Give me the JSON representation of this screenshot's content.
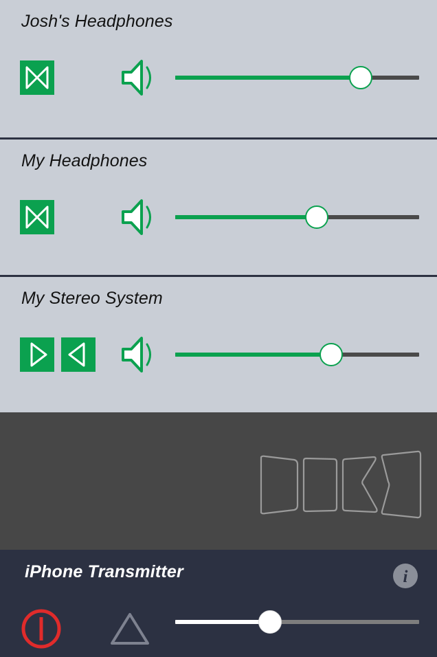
{
  "app": {
    "background_color": "#c9ced6",
    "accent_color": "#0ba14f",
    "divider_color": "#2c3142",
    "track_color": "#4a4a4a"
  },
  "devices": [
    {
      "name": "Josh's Headphones",
      "buttons": [
        {
          "icon": "bowtie-both-channels-icon",
          "label": "Both channels"
        }
      ],
      "volume_icon": "speaker-volume-icon",
      "volume_percent": 76
    },
    {
      "name": "My Headphones",
      "buttons": [
        {
          "icon": "bowtie-both-channels-icon",
          "label": "Both channels"
        }
      ],
      "volume_icon": "speaker-volume-icon",
      "volume_percent": 58
    },
    {
      "name": "My Stereo System",
      "buttons": [
        {
          "icon": "triangle-right-channel-icon",
          "label": "Right channel"
        },
        {
          "icon": "triangle-left-channel-icon",
          "label": "Left channel"
        }
      ],
      "volume_icon": "speaker-volume-icon",
      "volume_percent": 64
    }
  ],
  "artwork": {
    "icon": "panels-outline-artwork",
    "background_color": "#474747",
    "stroke_color": "#9b9b9b"
  },
  "transmitter": {
    "title": "iPhone Transmitter",
    "background_color": "#2c3142",
    "info_icon": "info-icon",
    "power_icon": "power-icon",
    "power_color": "#e02b2b",
    "source_icon": "triangle-outline-icon",
    "volume_percent": 39
  }
}
